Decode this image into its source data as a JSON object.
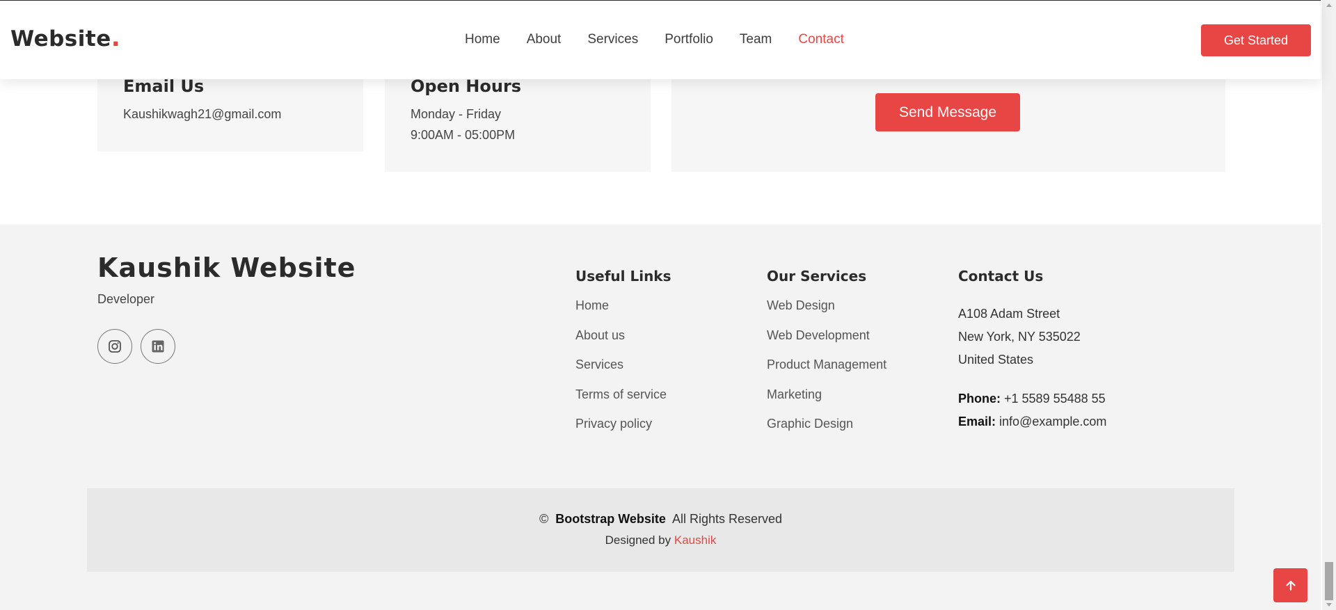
{
  "header": {
    "logo_text": "Website",
    "logo_dot": ".",
    "nav": [
      {
        "label": "Home"
      },
      {
        "label": "About"
      },
      {
        "label": "Services"
      },
      {
        "label": "Portfolio"
      },
      {
        "label": "Team"
      },
      {
        "label": "Contact",
        "active": true
      }
    ],
    "cta_label": "Get Started"
  },
  "contact": {
    "email": {
      "title": "Email Us",
      "value": "Kaushikwagh21@gmail.com"
    },
    "hours": {
      "title": "Open Hours",
      "days": "Monday - Friday",
      "time": "9:00AM - 05:00PM"
    },
    "send_label": "Send Message"
  },
  "footer": {
    "brand": "Kaushik Website",
    "subtitle": "Developer",
    "socials": [
      {
        "icon": "instagram-icon"
      },
      {
        "icon": "linkedin-icon"
      }
    ],
    "useful_links": {
      "title": "Useful Links",
      "items": [
        "Home",
        "About us",
        "Services",
        "Terms of service",
        "Privacy policy"
      ]
    },
    "services": {
      "title": "Our Services",
      "items": [
        "Web Design",
        "Web Development",
        "Product Management",
        "Marketing",
        "Graphic Design"
      ]
    },
    "contact_us": {
      "title": "Contact Us",
      "address": [
        "A108 Adam Street",
        "New York, NY 535022",
        "United States"
      ],
      "phone_label": "Phone:",
      "phone": "+1 5589 55488 55",
      "email_label": "Email:",
      "email": "info@example.com"
    },
    "copyright": {
      "symbol": "©",
      "brand": "Bootstrap Website",
      "rights": "All Rights Reserved",
      "designed_by": "Designed by",
      "designer": "Kaushik"
    }
  },
  "colors": {
    "accent": "#e84545",
    "footer_bg": "#f3f3f3",
    "copyright_bg": "#e8e8e8"
  }
}
